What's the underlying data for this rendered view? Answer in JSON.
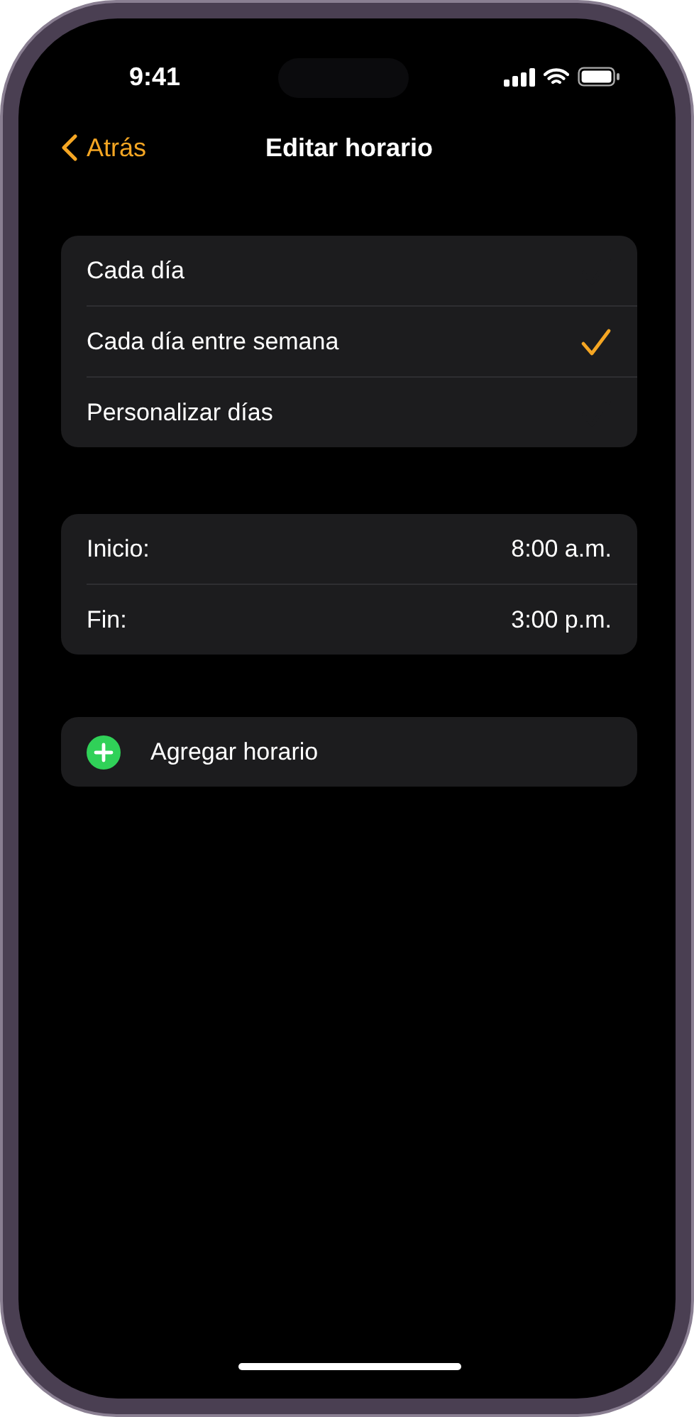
{
  "status_bar": {
    "time": "9:41"
  },
  "nav": {
    "back": "Atrás",
    "title": "Editar horario"
  },
  "repeat_options": [
    {
      "label": "Cada día",
      "selected": false
    },
    {
      "label": "Cada día entre semana",
      "selected": true
    },
    {
      "label": "Personalizar días",
      "selected": false
    }
  ],
  "times": [
    {
      "label": "Inicio:",
      "value": "8:00 a.m."
    },
    {
      "label": "Fin:",
      "value": "3:00 p.m."
    }
  ],
  "add_button": {
    "label": "Agregar horario"
  }
}
